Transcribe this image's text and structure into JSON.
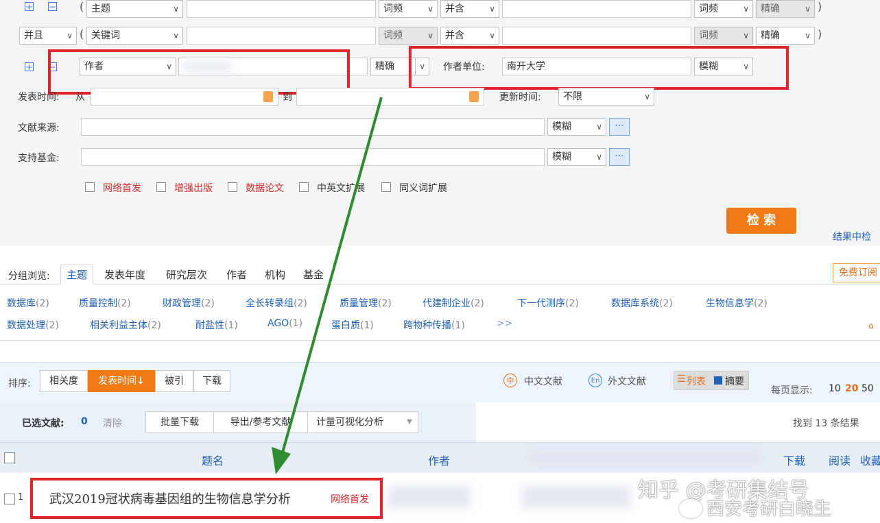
{
  "search_rows": [
    {
      "logic": "",
      "field": "主题",
      "freq": "词频",
      "combine": "并含",
      "freq2": "词频",
      "match": "精确"
    },
    {
      "logic": "并且",
      "field": "关键词",
      "freq": "词频",
      "combine": "并含",
      "freq2": "词频",
      "match": "精确"
    }
  ],
  "author_row": {
    "field": "作者",
    "match": "精确",
    "unit_label": "作者单位:",
    "unit_value": "南开大学",
    "unit_match": "模糊"
  },
  "pub_time": {
    "label": "发表时间:",
    "from": "从",
    "to": "到",
    "update_label": "更新时间:",
    "update_value": "不限"
  },
  "source": {
    "label": "文献来源:",
    "match": "模糊",
    "more": "···"
  },
  "fund": {
    "label": "支持基金:",
    "match": "模糊",
    "more": "···"
  },
  "checkboxes": [
    {
      "label": "网络首发",
      "color": "#d12b2b"
    },
    {
      "label": "增强出版",
      "color": "#d12b2b"
    },
    {
      "label": "数据论文",
      "color": "#d12b2b"
    },
    {
      "label": "中英文扩展",
      "color": "#333333"
    },
    {
      "label": "同义词扩展",
      "color": "#333333"
    }
  ],
  "search_button": "检 索",
  "result_search_link": "结果中检",
  "group_browse": {
    "label": "分组浏览:",
    "tabs": [
      "主题",
      "发表年度",
      "研究层次",
      "作者",
      "机构",
      "基金"
    ],
    "free_sub": "免费订阅"
  },
  "topics_row1": [
    {
      "name": "数据库",
      "count": "(2)"
    },
    {
      "name": "质量控制",
      "count": "(2)"
    },
    {
      "name": "财政管理",
      "count": "(2)"
    },
    {
      "name": "全长转录组",
      "count": "(2)"
    },
    {
      "name": "质量管理",
      "count": "(2)"
    },
    {
      "name": "代建制企业",
      "count": "(2)"
    },
    {
      "name": "下一代测序",
      "count": "(2)"
    },
    {
      "name": "数据库系统",
      "count": "(2)"
    },
    {
      "name": "生物信息学",
      "count": "(2)"
    }
  ],
  "topics_row2": [
    {
      "name": "数据处理",
      "count": "(2)"
    },
    {
      "name": "相关利益主体",
      "count": "(2)"
    },
    {
      "name": "耐盐性",
      "count": "(1)"
    },
    {
      "name": "AGO",
      "count": "(1)"
    },
    {
      "name": "蛋白质",
      "count": "(1)"
    },
    {
      "name": "跨物种传播",
      "count": "(1)"
    }
  ],
  "more_topics": ">>",
  "sort": {
    "label": "排序:",
    "options": [
      "相关度",
      "发表时间",
      "被引",
      "下载"
    ],
    "cn_lit": "中文文献",
    "foreign_lit": "外文文献",
    "list_view": "列表",
    "abstract_view": "摘要",
    "per_page_label": "每页显示:",
    "per_page": [
      "10",
      "20",
      "50"
    ]
  },
  "toolbar": {
    "selected_label": "已选文献:",
    "selected_count": "0",
    "clear": "清除",
    "batch_download": "批量下载",
    "export": "导出/参考文献",
    "visual": "计量可视化分析",
    "found": "找到 13 条结果"
  },
  "table": {
    "headers": {
      "title": "题名",
      "author": "作者",
      "download": "下载",
      "read": "阅读",
      "collect": "收藏"
    },
    "rows": [
      {
        "index": "1",
        "title": "武汉2019冠状病毒基因组的生物信息学分析",
        "badge": "网络首发"
      }
    ]
  },
  "watermark": {
    "line1": "知乎 @考研集结号",
    "line2": "西安考研白晓生"
  }
}
